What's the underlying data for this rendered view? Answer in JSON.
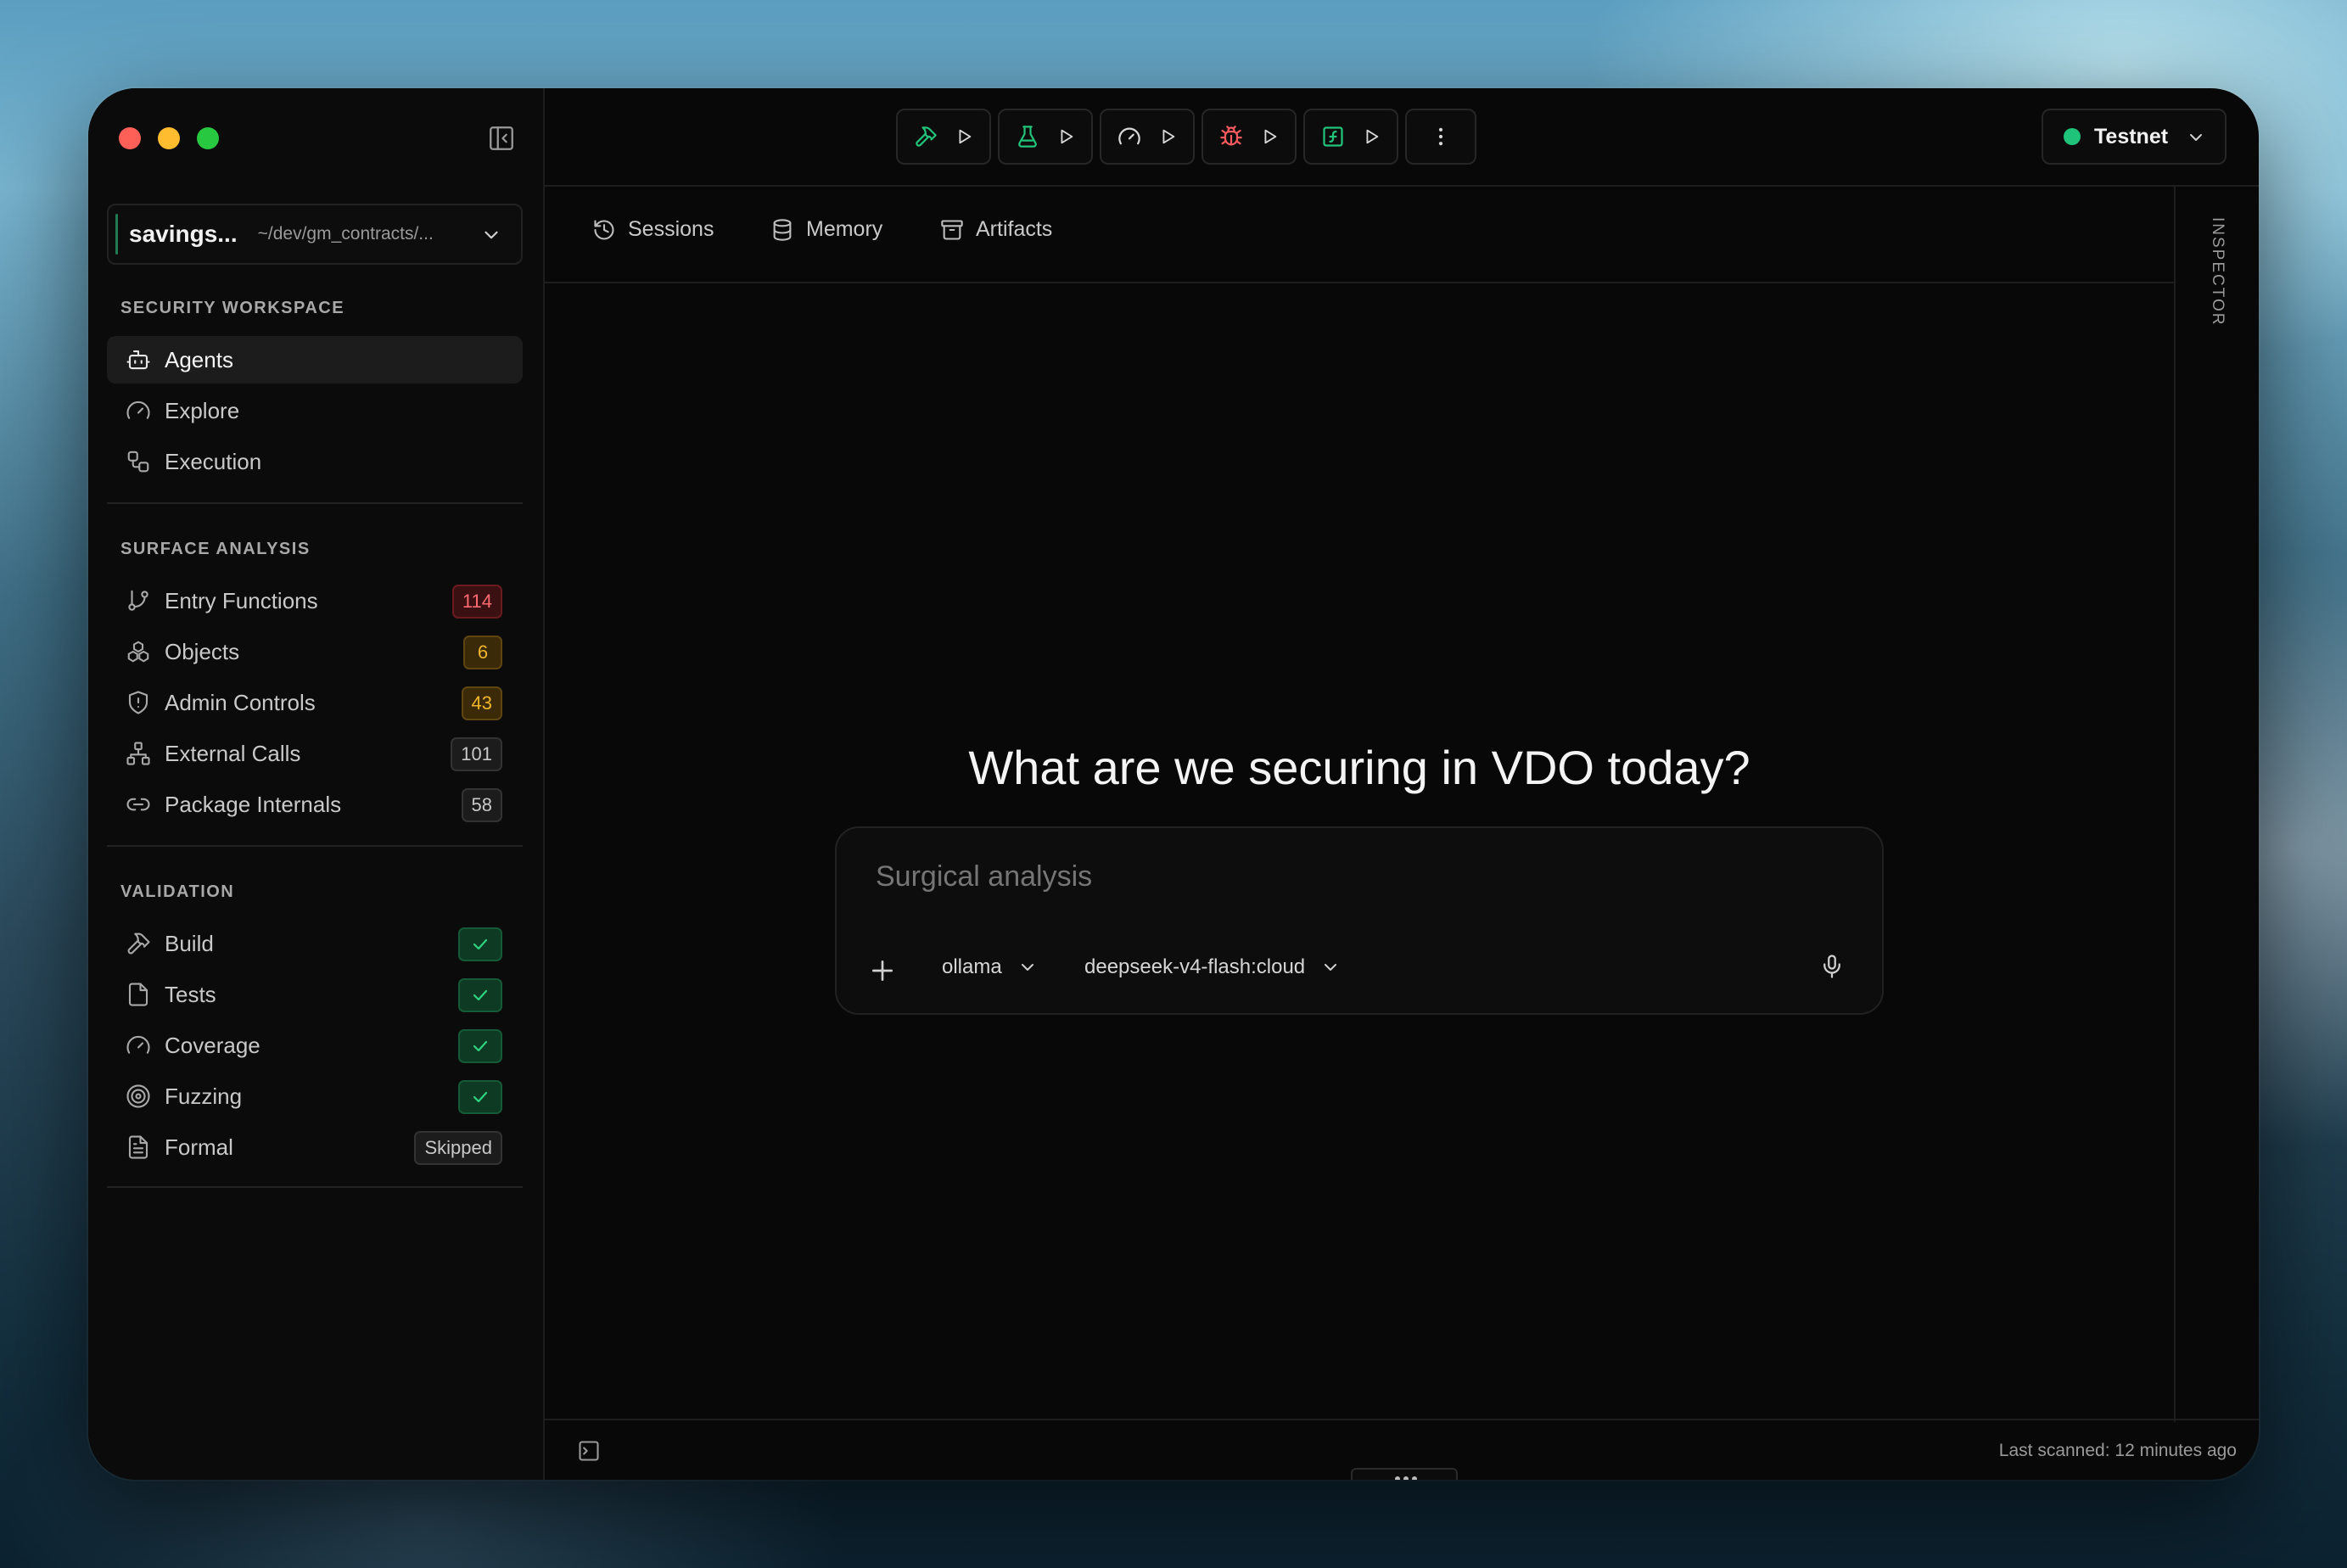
{
  "window": {
    "traffic_lights": [
      "close",
      "minimize",
      "zoom"
    ]
  },
  "sidebar": {
    "project": {
      "name": "savings...",
      "path": "~/dev/gm_contracts/..."
    },
    "sections": [
      {
        "title": "SECURITY WORKSPACE",
        "items": [
          {
            "label": "Agents",
            "icon": "bot-icon",
            "active": true
          },
          {
            "label": "Explore",
            "icon": "gauge-icon"
          },
          {
            "label": "Execution",
            "icon": "workflow-icon"
          }
        ]
      },
      {
        "title": "SURFACE ANALYSIS",
        "items": [
          {
            "label": "Entry Functions",
            "icon": "git-branch-icon",
            "badge": "114",
            "badge_style": "red"
          },
          {
            "label": "Objects",
            "icon": "boxes-icon",
            "badge": "6",
            "badge_style": "amber"
          },
          {
            "label": "Admin Controls",
            "icon": "shield-icon",
            "badge": "43",
            "badge_style": "amber"
          },
          {
            "label": "External Calls",
            "icon": "network-icon",
            "badge": "101",
            "badge_style": "gray"
          },
          {
            "label": "Package Internals",
            "icon": "link-icon",
            "badge": "58",
            "badge_style": "gray"
          }
        ]
      },
      {
        "title": "VALIDATION",
        "items": [
          {
            "label": "Build",
            "icon": "hammer-icon",
            "status": "check"
          },
          {
            "label": "Tests",
            "icon": "file-check-icon",
            "status": "check"
          },
          {
            "label": "Coverage",
            "icon": "gauge-icon",
            "status": "check"
          },
          {
            "label": "Fuzzing",
            "icon": "target-icon",
            "status": "check"
          },
          {
            "label": "Formal",
            "icon": "file-text-icon",
            "badge": "Skipped",
            "badge_style": "gray"
          }
        ]
      }
    ]
  },
  "toolbar": {
    "buttons": [
      {
        "icon": "hammer-icon",
        "color": "#22c47a"
      },
      {
        "icon": "flask-icon",
        "color": "#22c47a"
      },
      {
        "icon": "gauge-icon",
        "color": "#d8d8d8"
      },
      {
        "icon": "bug-icon",
        "color": "#ff5a5f"
      },
      {
        "icon": "function-icon",
        "color": "#22c47a"
      }
    ],
    "network": {
      "label": "Testnet",
      "status_color": "#20c37a"
    }
  },
  "tabs": [
    {
      "label": "Sessions",
      "icon": "history-icon"
    },
    {
      "label": "Memory",
      "icon": "database-icon"
    },
    {
      "label": "Artifacts",
      "icon": "archive-icon"
    }
  ],
  "inspector": {
    "label": "INSPECTOR"
  },
  "main": {
    "headline": "What are we securing in VDO today?",
    "composer": {
      "placeholder": "Surgical analysis",
      "provider": "ollama",
      "model": "deepseek-v4-flash:cloud"
    }
  },
  "footer": {
    "last_scanned": "Last scanned: 12 minutes ago"
  },
  "colors": {
    "accent_green": "#20c37a",
    "danger_red": "#ff6a70",
    "warning_amber": "#f1b52b",
    "background": "#080808"
  }
}
